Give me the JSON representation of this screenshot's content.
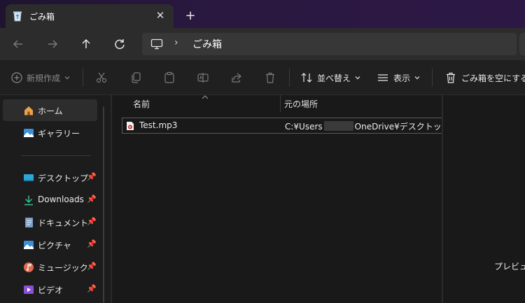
{
  "window": {
    "tab_title": "ごみ箱",
    "close_glyph": "✕",
    "new_tab_glyph": "+"
  },
  "address": {
    "separator": "›",
    "path": "ごみ箱"
  },
  "commands": {
    "new": "新規作成",
    "sort": "並べ替え",
    "view": "表示",
    "empty_recycle": "ごみ箱を空にする"
  },
  "sidebar": {
    "items": [
      {
        "label": "ホーム",
        "icon": "home-icon"
      },
      {
        "label": "ギャラリー",
        "icon": "gallery-icon"
      },
      {
        "label": "デスクトップ",
        "icon": "desktop-folder-icon"
      },
      {
        "label": "Downloads",
        "icon": "download-icon"
      },
      {
        "label": "ドキュメント",
        "icon": "documents-icon"
      },
      {
        "label": "ピクチャ",
        "icon": "pictures-icon"
      },
      {
        "label": "ミュージック",
        "icon": "music-icon"
      },
      {
        "label": "ビデオ",
        "icon": "videos-icon"
      }
    ]
  },
  "table": {
    "columns": [
      "名前",
      "元の場所"
    ],
    "rows": [
      {
        "name": "Test.mp3",
        "location_prefix": "C:¥Users",
        "location_suffix": "OneDrive¥デスクトップ"
      }
    ]
  },
  "preview": {
    "text": "プレビューを"
  },
  "colors": {
    "accent": "#4aa3df",
    "titlebar": "#2a1840",
    "background": "#191919"
  }
}
